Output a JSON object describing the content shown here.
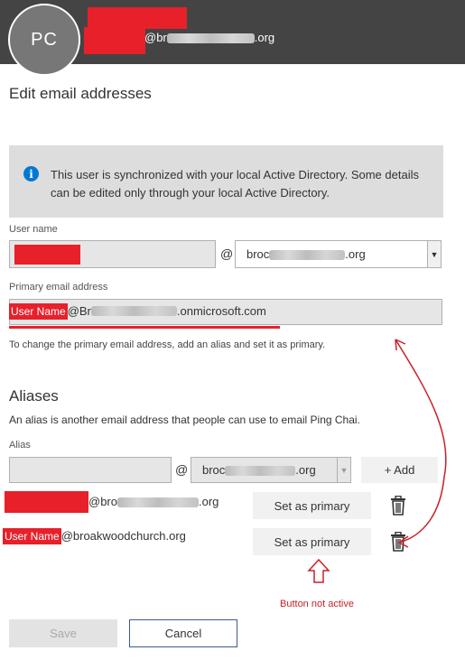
{
  "header": {
    "avatar_initials": "PC",
    "email_prefix": "@br",
    "email_suffix": ".org"
  },
  "page_title": "Edit email addresses",
  "info": {
    "text": "This user is synchronized with your local Active Directory. Some details can be edited only through your local Active Directory."
  },
  "username": {
    "label": "User name",
    "at": "@",
    "domain_prefix": "broc",
    "domain_suffix": ".org"
  },
  "primary": {
    "label": "Primary email address",
    "name_tag": "User Name",
    "email_prefix": "@Br",
    "email_suffix": ".onmicrosoft.com",
    "hint": "To change the primary email address, add an alias and set it as primary."
  },
  "aliases": {
    "heading": "Aliases",
    "description": "An alias is another email address that people can use to email Ping Chai.",
    "alias_label": "Alias",
    "at": "@",
    "domain_prefix": "broc",
    "domain_suffix": ".org",
    "add_label": "+ Add",
    "items": [
      {
        "email_prefix": "@bro",
        "email_suffix": ".org",
        "action": "Set as primary"
      },
      {
        "name_tag": "User Name",
        "email": "@broakwoodchurch.org",
        "action": "Set as primary"
      }
    ]
  },
  "annotation": {
    "text": "Button not active",
    "color": "#c8202a"
  },
  "footer": {
    "save_label": "Save",
    "cancel_label": "Cancel"
  },
  "colors": {
    "header_bg": "#444444",
    "redaction": "#e8202a",
    "info_blue": "#0078d4",
    "cancel_border": "#3a5b8e"
  },
  "icons": [
    "info-icon",
    "chevron-down-icon",
    "trash-icon",
    "up-arrow-icon"
  ]
}
